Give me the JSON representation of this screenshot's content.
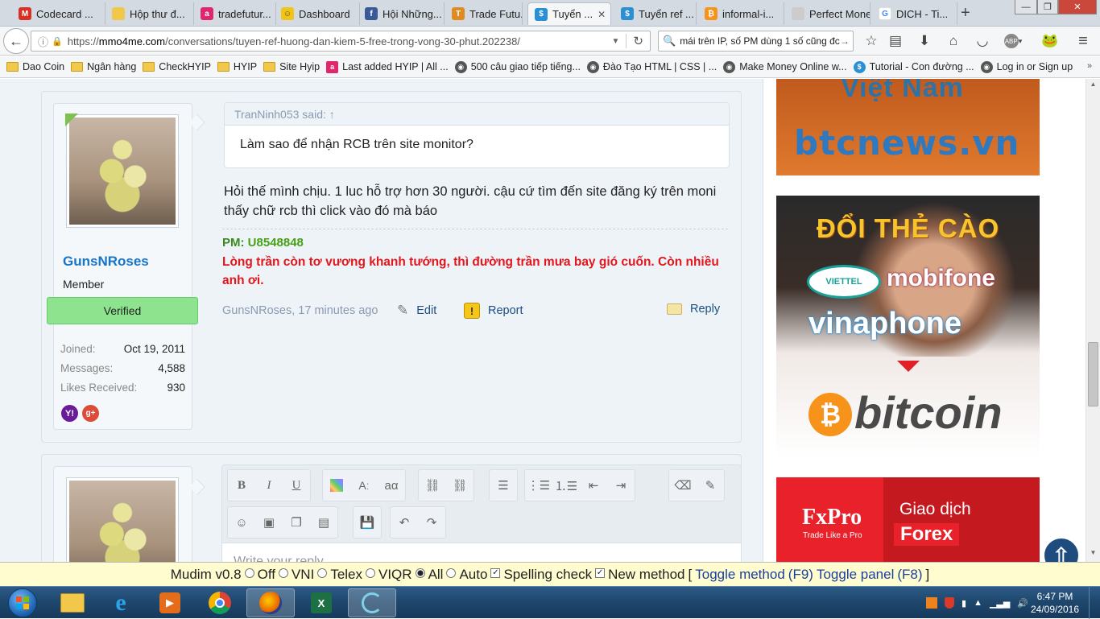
{
  "browser": {
    "tabs": [
      {
        "label": "Codecard ...",
        "icon": "gmail-icon",
        "color": "#d93025",
        "glyph": "M"
      },
      {
        "label": "Hộp thư đ...",
        "icon": "folder-icon",
        "color": "#f2c84b",
        "glyph": ""
      },
      {
        "label": "tradefutur...",
        "icon": "a-icon",
        "color": "#e0266c",
        "glyph": "a"
      },
      {
        "label": "Dashboard",
        "icon": "dashboard-icon",
        "color": "#f0c419",
        "glyph": "☺"
      },
      {
        "label": "Hội Những...",
        "icon": "facebook-icon",
        "color": "#3b5998",
        "glyph": "f"
      },
      {
        "label": "Trade Futu...",
        "icon": "tradefutures-icon",
        "color": "#e08b22",
        "glyph": "T"
      },
      {
        "label": "Tuyển ...",
        "icon": "mmo4me-icon",
        "color": "#2b8fd6",
        "glyph": "$",
        "active": true
      },
      {
        "label": "Tuyển ref ...",
        "icon": "mmo4me-icon",
        "color": "#2b8fd6",
        "glyph": "$"
      },
      {
        "label": "informal-i...",
        "icon": "bitcoin-icon",
        "color": "#f7931a",
        "glyph": "₿"
      },
      {
        "label": "Perfect Money...",
        "icon": "page-icon",
        "color": "#cccccc",
        "glyph": ""
      },
      {
        "label": "DICH - Ti...",
        "icon": "google-icon",
        "color": "#ffffff",
        "glyph": "G"
      }
    ],
    "url_prefix": "https://",
    "url_domain": "mmo4me.com",
    "url_path": "/conversations/tuyen-ref-huong-dan-kiem-5-free-trong-vong-30-phut.202238/",
    "search_text": "mái trên IP, số PM dùng 1 số cũng đc",
    "bookmarks": [
      {
        "label": "Dao Coin",
        "icon": "folder-icon"
      },
      {
        "label": "Ngân hàng",
        "icon": "folder-icon"
      },
      {
        "label": "CheckHYIP",
        "icon": "folder-icon"
      },
      {
        "label": "HYIP",
        "icon": "folder-icon"
      },
      {
        "label": "Site Hyip",
        "icon": "folder-icon"
      },
      {
        "label": "Last added HYIP | All ...",
        "icon": "a-icon"
      },
      {
        "label": "500 câu giao tiếp tiếng...",
        "icon": "globe-icon"
      },
      {
        "label": "Đào Tạo HTML | CSS | ...",
        "icon": "globe-icon"
      },
      {
        "label": "Make Money Online w...",
        "icon": "globe-icon"
      },
      {
        "label": "Tutorial - Con đường ...",
        "icon": "mmo4me-icon"
      },
      {
        "label": "Log in or Sign up",
        "icon": "globe-icon"
      }
    ]
  },
  "post": {
    "username": "GunsNRoses",
    "user_title": "Member",
    "verified_label": "Verified",
    "stats": [
      {
        "label": "Joined:",
        "value": "Oct 19, 2011"
      },
      {
        "label": "Messages:",
        "value": "4,588"
      },
      {
        "label": "Likes Received:",
        "value": "930"
      }
    ],
    "quote_author": "TranNinh053 said: ↑",
    "quote_text": "Làm sao để nhận RCB trên site monitor?",
    "message": "Hỏi thế mình chịu. 1 luc hỗ trợ hơn 30 người. cậu cứ tìm đến site đăng ký trên moni thấy chữ rcb thì click vào đó mà báo",
    "pm_label": "PM: ",
    "pm_code": "U8548848",
    "signature": "Lòng trần còn tơ vương khanh tướng, thì đường trần mưa bay gió cuốn. Còn nhiều anh ơi.",
    "meta": "GunsNRoses, 17 minutes ago",
    "edit_label": "Edit",
    "report_label": "Report",
    "reply_label": "Reply"
  },
  "reply_editor": {
    "placeholder": "Write your reply..."
  },
  "ads": {
    "ad1_text": "btcnews.vn",
    "ad1_top": "Việt Nam",
    "ad2_title": "ĐỔI THẺ CÀO",
    "ad2_brands": [
      "VIETTEL",
      "mobifone",
      "vinaphone"
    ],
    "ad2_coin": "bitcoin",
    "ad3_brand": "FxPro",
    "ad3_tagline": "Trade Like a Pro",
    "ad3_text1": "Giao dịch",
    "ad3_text2": "Forex"
  },
  "mudim": {
    "name": "Mudim v0.8",
    "options": [
      "Off",
      "VNI",
      "Telex",
      "VIQR",
      "All",
      "Auto"
    ],
    "selected": "All",
    "spelling": "Spelling check",
    "newmethod": "New method",
    "toggle_method": "Toggle method",
    "f9": "(F9)",
    "toggle_panel": "Toggle panel",
    "f8": "(F8)"
  },
  "taskbar": {
    "time": "6:47 PM",
    "date": "24/09/2016"
  }
}
